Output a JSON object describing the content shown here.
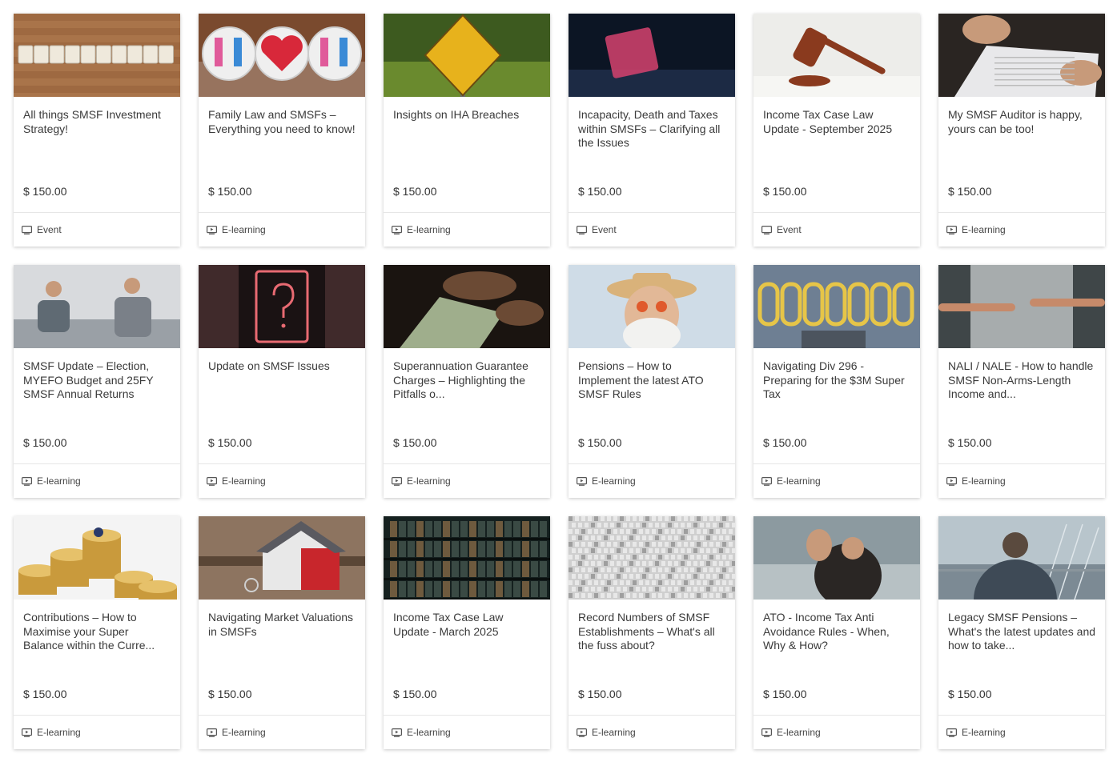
{
  "cards": [
    {
      "title": "All things SMSF Investment Strategy!",
      "price": "$ 150.00",
      "type": "Event",
      "icon": "calendar-monitor-icon",
      "image": "investment-tiles",
      "colors": [
        "#a9744a",
        "#8a5630",
        "#efe9dc"
      ]
    },
    {
      "title": "Family Law and SMSFs – Everything you need to know!",
      "price": "$ 150.00",
      "type": "E-learning",
      "icon": "play-screen-icon",
      "image": "broken-hearts-badges",
      "colors": [
        "#7a4a2e",
        "#efefef",
        "#d8283a"
      ]
    },
    {
      "title": "Insights on IHA Breaches",
      "price": "$ 150.00",
      "type": "E-learning",
      "icon": "play-screen-icon",
      "image": "caution-ahead-sign",
      "colors": [
        "#3d5a1f",
        "#6a8a2e",
        "#e7b21c"
      ]
    },
    {
      "title": "Incapacity, Death and Taxes within SMSFs – Clarifying all the Issues",
      "price": "$ 150.00",
      "type": "Event",
      "icon": "calendar-monitor-icon",
      "image": "exit-neon-sign",
      "colors": [
        "#0c1524",
        "#1c2a44",
        "#d6426f"
      ]
    },
    {
      "title": "Income Tax Case Law Update - September 2025",
      "price": "$ 150.00",
      "type": "Event",
      "icon": "calendar-monitor-icon",
      "image": "gavel",
      "colors": [
        "#ededea",
        "#f6f6f3",
        "#8a3a1e"
      ]
    },
    {
      "title": "My SMSF Auditor is happy, yours can be too!",
      "price": "$ 150.00",
      "type": "E-learning",
      "icon": "play-screen-icon",
      "image": "signing-document",
      "colors": [
        "#2a2522",
        "#e8e8ea",
        "#c79a7a"
      ]
    },
    {
      "title": "SMSF Update – Election, MYEFO Budget and 25FY SMSF Annual Returns",
      "price": "$ 150.00",
      "type": "E-learning",
      "icon": "play-screen-icon",
      "image": "two-men-meeting",
      "colors": [
        "#d8dadd",
        "#9aa0a6",
        "#5f6a73"
      ]
    },
    {
      "title": "Update on SMSF Issues",
      "price": "$ 150.00",
      "type": "E-learning",
      "icon": "play-screen-icon",
      "image": "neon-question-mark",
      "colors": [
        "#1a1213",
        "#5a3a3c",
        "#e86a72"
      ]
    },
    {
      "title": "Superannuation Guarantee Charges – Highlighting the Pitfalls o...",
      "price": "$ 150.00",
      "type": "E-learning",
      "icon": "play-screen-icon",
      "image": "hands-counting-money",
      "colors": [
        "#1a1410",
        "#6b4a34",
        "#9fae8c"
      ]
    },
    {
      "title": "Pensions – How to Implement the latest ATO SMSF Rules",
      "price": "$ 150.00",
      "type": "E-learning",
      "icon": "play-screen-icon",
      "image": "old-man-hat",
      "colors": [
        "#cfdce7",
        "#f2f2f0",
        "#e05a2c"
      ]
    },
    {
      "title": "Navigating Div 296 - Preparing for the $3M Super Tax",
      "price": "$ 150.00",
      "type": "E-learning",
      "icon": "play-screen-icon",
      "image": "caution-wall-paint",
      "colors": [
        "#5d6f84",
        "#7f8fa1",
        "#e6c548"
      ]
    },
    {
      "title": "NALI / NALE - How to handle SMSF Non-Arms-Length Income and...",
      "price": "$ 150.00",
      "type": "E-learning",
      "icon": "play-screen-icon",
      "image": "reaching-hands",
      "colors": [
        "#3f4648",
        "#a7acad",
        "#c68a6a"
      ]
    },
    {
      "title": "Contributions – How to Maximise your Super Balance within the Curre...",
      "price": "$ 150.00",
      "type": "E-learning",
      "icon": "play-screen-icon",
      "image": "coin-stacks",
      "colors": [
        "#f4f4f4",
        "#c99a3c",
        "#e6c16a"
      ]
    },
    {
      "title": "Navigating Market Valuations in SMSFs",
      "price": "$ 150.00",
      "type": "E-learning",
      "icon": "play-screen-icon",
      "image": "house-keys",
      "colors": [
        "#5a4636",
        "#8d7460",
        "#c8262c"
      ]
    },
    {
      "title": "Income Tax Case Law Update - March 2025",
      "price": "$ 150.00",
      "type": "E-learning",
      "icon": "play-screen-icon",
      "image": "library-shelves",
      "colors": [
        "#15201f",
        "#3a4a44",
        "#6e5a3e"
      ]
    },
    {
      "title": "Record Numbers of SMSF Establishments – What's all the fuss about?",
      "price": "$ 150.00",
      "type": "E-learning",
      "icon": "play-screen-icon",
      "image": "tiny-figures-crowd",
      "colors": [
        "#cfcfcf",
        "#9e9e9e",
        "#e8e8e8"
      ]
    },
    {
      "title": "ATO - Income Tax Anti Avoidance Rules - When, Why & How?",
      "price": "$ 150.00",
      "type": "E-learning",
      "icon": "play-screen-icon",
      "image": "person-hand-raised",
      "colors": [
        "#8c9aa0",
        "#2a2624",
        "#b7c1c4"
      ]
    },
    {
      "title": "Legacy SMSF Pensions – What's the latest updates and how to take...",
      "price": "$ 150.00",
      "type": "E-learning",
      "icon": "play-screen-icon",
      "image": "man-bridge-river",
      "colors": [
        "#b8c5cc",
        "#3e4a56",
        "#7c8a94"
      ]
    }
  ]
}
